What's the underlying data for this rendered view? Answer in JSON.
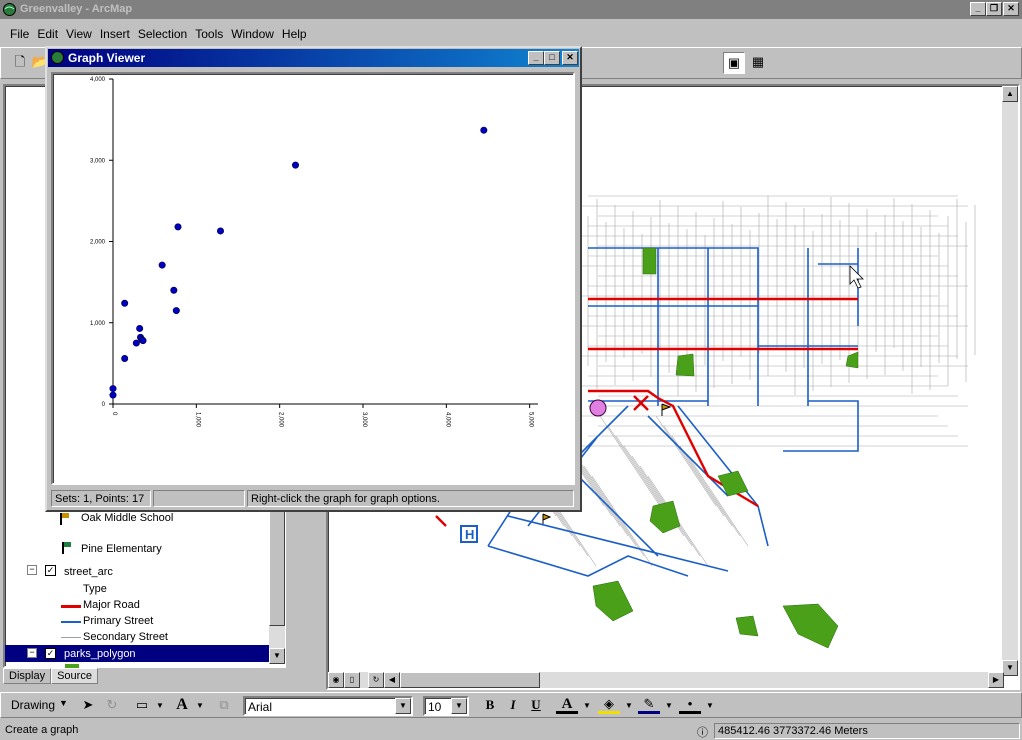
{
  "window": {
    "title": "Greenvalley - ArcMap"
  },
  "menu": [
    "File",
    "Edit",
    "View",
    "Insert",
    "Selection",
    "Tools",
    "Window",
    "Help"
  ],
  "graph_viewer": {
    "title": "Graph Viewer",
    "status_sets": "Sets: 1, Points: 17",
    "status_hint": "Right-click the graph for graph options."
  },
  "chart_data": {
    "type": "scatter",
    "y_ticks": [
      "0",
      "1,000",
      "2,000",
      "3,000",
      "4,000"
    ],
    "x_ticks": [
      "0",
      "1,000",
      "2,000",
      "3,000",
      "4,000",
      "5,000"
    ],
    "xlim": [
      0,
      5100
    ],
    "ylim": [
      0,
      4000
    ],
    "x": [
      0,
      0,
      140,
      140,
      280,
      330,
      350,
      320,
      360,
      590,
      730,
      760,
      780,
      1290,
      2190,
      4450
    ],
    "y": [
      110,
      190,
      560,
      1240,
      750,
      820,
      790,
      930,
      780,
      1710,
      1400,
      1150,
      2180,
      2130,
      2940,
      3370
    ],
    "point_color": "#0000c0"
  },
  "toc": {
    "items": [
      {
        "label": "Oak Middle School",
        "kind": "school"
      },
      {
        "label": "Pine Elementary",
        "kind": "school"
      },
      {
        "label": "street_arc",
        "kind": "layer"
      },
      {
        "label": "Type",
        "kind": "heading"
      },
      {
        "label": "Major Road",
        "kind": "legend",
        "color": "#e00000"
      },
      {
        "label": "Primary Street",
        "kind": "legend",
        "color": "#1c5fc8"
      },
      {
        "label": "Secondary Street",
        "kind": "legend",
        "color": "#a0a0a0"
      },
      {
        "label": "parks_polygon",
        "kind": "layer-selected"
      }
    ],
    "tabs": [
      "Display",
      "Source"
    ]
  },
  "map": {
    "major_road_color": "#e00000",
    "primary_street_color": "#1c5fc8",
    "secondary_street_color": "#a8a8a8",
    "park_color": "#4aa018"
  },
  "drawing_toolbar": {
    "drawing_label": "Drawing",
    "font_name": "Arial",
    "font_size": "10",
    "bold": "B",
    "italic": "I",
    "underline": "U",
    "text_tool": "A"
  },
  "statusbar": {
    "message": "Create a graph",
    "coordinates": "485412.46  3773372.46 Meters"
  }
}
